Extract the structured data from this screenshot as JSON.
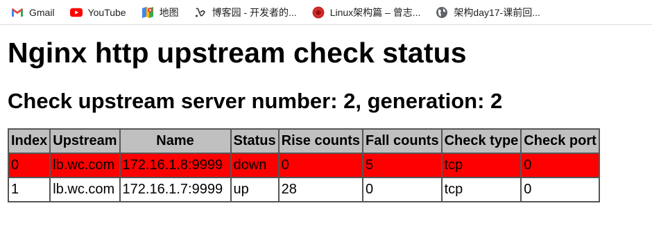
{
  "bookmarks": [
    {
      "label": "Gmail",
      "icon": "gmail-icon"
    },
    {
      "label": "YouTube",
      "icon": "youtube-icon"
    },
    {
      "label": "地图",
      "icon": "maps-icon"
    },
    {
      "label": "博客园 - 开发者的...",
      "icon": "cnblogs-icon"
    },
    {
      "label": "Linux架构篇 – 曾志...",
      "icon": "rose-icon"
    },
    {
      "label": "架构day17-课前回...",
      "icon": "globe-icon"
    }
  ],
  "page": {
    "title": "Nginx http upstream check status",
    "subtitle": "Check upstream server number: 2, generation: 2"
  },
  "table": {
    "headers": [
      "Index",
      "Upstream",
      "Name",
      "Status",
      "Rise counts",
      "Fall counts",
      "Check type",
      "Check port"
    ],
    "rows": [
      {
        "index": "0",
        "upstream": "lb.wc.com",
        "name": "172.16.1.8:9999",
        "status": "down",
        "rise": "0",
        "fall": "5",
        "type": "tcp",
        "port": "0",
        "color": "#ff0000"
      },
      {
        "index": "1",
        "upstream": "lb.wc.com",
        "name": "172.16.1.7:9999",
        "status": "up",
        "rise": "28",
        "fall": "0",
        "type": "tcp",
        "port": "0",
        "color": "#ffffff"
      }
    ]
  }
}
